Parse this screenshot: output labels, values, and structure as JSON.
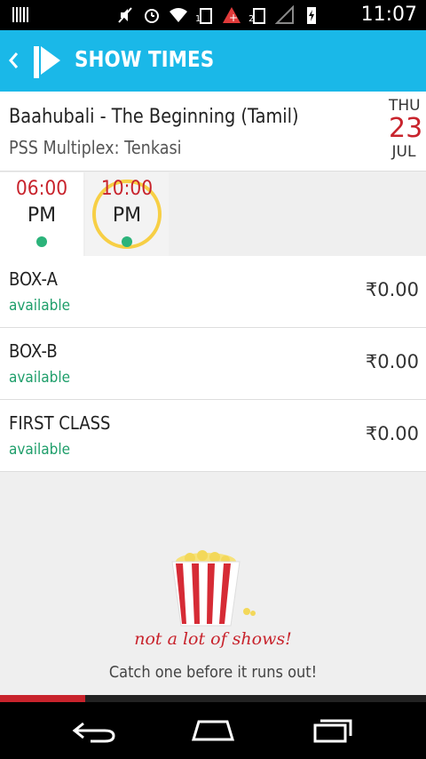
{
  "status_bar": {
    "time": "11:07",
    "icons": [
      "mute-icon",
      "alarm-icon",
      "wifi-icon",
      "sim1-icon",
      "alert-icon",
      "sim2-icon",
      "signal-icon",
      "battery-icon"
    ]
  },
  "app_bar": {
    "title": "SHOW TIMES",
    "color": "#1ab8e8"
  },
  "movie": {
    "title": "Baahubali - The Beginning (Tamil)",
    "venue": "PSS Multiplex: Tenkasi"
  },
  "date": {
    "day_of_week": "THU",
    "day": "23",
    "month": "JUL"
  },
  "showtimes": [
    {
      "time": "06:00",
      "ampm": "PM",
      "selected": false
    },
    {
      "time": "10:00",
      "ampm": "PM",
      "selected": true
    }
  ],
  "seat_classes": [
    {
      "name": "BOX-A",
      "status": "available",
      "price": "₹0.00"
    },
    {
      "name": "BOX-B",
      "status": "available",
      "price": "₹0.00"
    },
    {
      "name": "FIRST CLASS",
      "status": "available",
      "price": "₹0.00"
    }
  ],
  "empty_state": {
    "title": "not a lot of shows!",
    "subtitle": "Catch one before it runs out!"
  },
  "progress": {
    "fraction": 0.2
  },
  "colors": {
    "accent_red": "#c8232c",
    "available_green": "#1e9e6a",
    "ring_yellow": "#f7cf45"
  }
}
